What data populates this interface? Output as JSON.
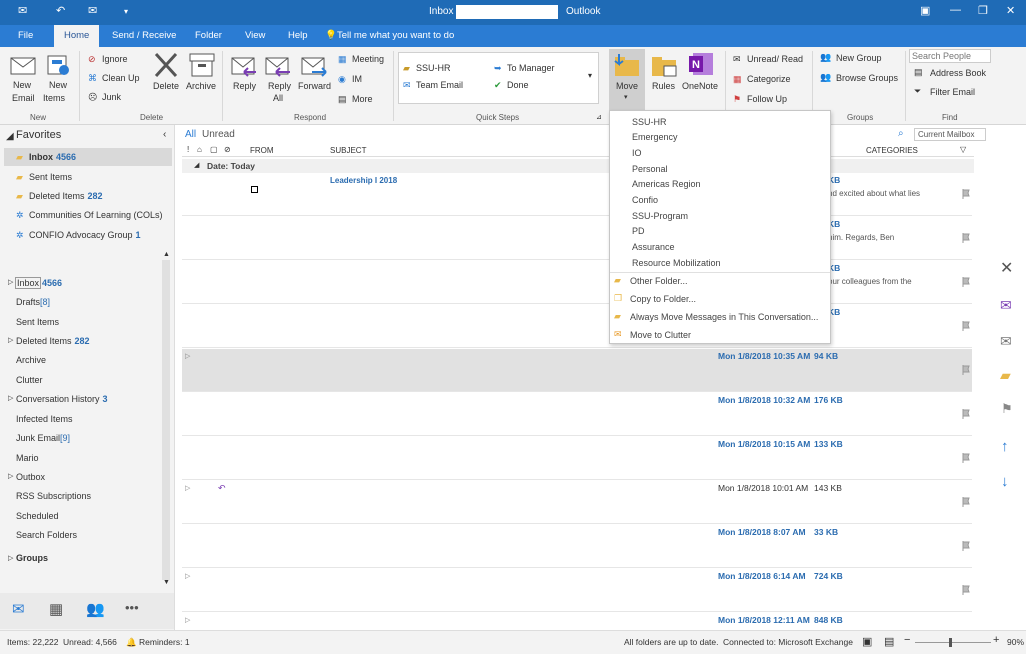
{
  "window": {
    "title_left": "Inbox",
    "title_right": "Outlook"
  },
  "tabs": [
    "File",
    "Home",
    "Send / Receive",
    "Folder",
    "View",
    "Help"
  ],
  "tell_me": "Tell me what you want to do",
  "ribbon": {
    "new": {
      "new_email": [
        "New",
        "Email"
      ],
      "new_items": [
        "New",
        "Items"
      ],
      "group": "New"
    },
    "delete": {
      "ignore": "Ignore",
      "clean_up": "Clean Up",
      "junk": "Junk",
      "delete": "Delete",
      "archive": "Archive",
      "group": "Delete"
    },
    "respond": {
      "reply": "Reply",
      "reply_all": [
        "Reply",
        "All"
      ],
      "forward": "Forward",
      "meeting": "Meeting",
      "im": "IM",
      "more": "More",
      "group": "Respond"
    },
    "quick_steps": {
      "items": [
        "SSU-HR",
        "To Manager",
        "Team Email",
        "Done"
      ],
      "group": "Quick Steps"
    },
    "move": {
      "move": "Move",
      "rules": "Rules",
      "onenote": "OneNote"
    },
    "tags": {
      "unread_read": "Unread/ Read",
      "categorize": "Categorize",
      "follow_up": "Follow Up"
    },
    "groups": {
      "new_group": "New Group",
      "browse_groups": "Browse Groups",
      "group": "Groups"
    },
    "find": {
      "search_people": "Search People",
      "address_book": "Address Book",
      "filter_email": "Filter Email",
      "group": "Find"
    }
  },
  "favorites": {
    "header": "Favorites",
    "items": [
      {
        "label": "Inbox",
        "count": "4566"
      },
      {
        "label": "Sent Items",
        "count": ""
      },
      {
        "label": "Deleted Items",
        "count": "282"
      },
      {
        "label": "Communities Of Learning (COLs)",
        "count": ""
      },
      {
        "label": "CONFIO Advocacy Group",
        "count": "1"
      }
    ]
  },
  "folders": [
    {
      "label": "Inbox",
      "count": "4566"
    },
    {
      "label": "Drafts",
      "count": "[8]"
    },
    {
      "label": "Sent Items",
      "count": ""
    },
    {
      "label": "Deleted Items",
      "count": "282"
    },
    {
      "label": "Archive",
      "count": ""
    },
    {
      "label": "Clutter",
      "count": ""
    },
    {
      "label": "Conversation History",
      "count": "3"
    },
    {
      "label": "Infected Items",
      "count": ""
    },
    {
      "label": "Junk Email",
      "count": "[9]"
    },
    {
      "label": "Mario",
      "count": ""
    },
    {
      "label": "Outbox",
      "count": ""
    },
    {
      "label": "RSS Subscriptions",
      "count": ""
    },
    {
      "label": "Scheduled",
      "count": ""
    },
    {
      "label": "Search Folders",
      "count": ""
    },
    {
      "label": "Groups",
      "count": ""
    }
  ],
  "list": {
    "filter_all": "All",
    "filter_unread": "Unread",
    "search_scope": "Current Mailbox",
    "col_from": "FROM",
    "col_subject": "SUBJECT",
    "col_categories": "CATEGORIES",
    "group_header": "Date: Today",
    "rows": [
      {
        "date": "",
        "size": "KB",
        "preview": "nd excited about what lies",
        "unread": true
      },
      {
        "date": "",
        "size": "KB",
        "preview": "him.  Regards,  Ben",
        "unread": true
      },
      {
        "date": "",
        "size": "KB",
        "preview": "our colleagues from the",
        "unread": true
      },
      {
        "date": "",
        "size": "KB",
        "preview": "",
        "unread": true
      },
      {
        "date": "Mon 1/8/2018 10:35 AM",
        "size": "94 KB",
        "preview": "",
        "unread": true
      },
      {
        "date": "Mon 1/8/2018 10:32 AM",
        "size": "176 KB",
        "preview": "",
        "unread": true
      },
      {
        "date": "Mon 1/8/2018 10:15 AM",
        "size": "133 KB",
        "preview": "",
        "unread": true
      },
      {
        "date": "Mon 1/8/2018 10:01 AM",
        "size": "143 KB",
        "preview": "",
        "unread": false
      },
      {
        "date": "Mon 1/8/2018 8:07 AM",
        "size": "33 KB",
        "preview": "",
        "unread": true
      },
      {
        "date": "Mon 1/8/2018 6:14 AM",
        "size": "724 KB",
        "preview": "",
        "unread": true
      },
      {
        "date": "Mon 1/8/2018 12:11 AM",
        "size": "848 KB",
        "preview": "",
        "unread": true
      }
    ]
  },
  "move_menu": {
    "folders": [
      "SSU-HR",
      "Emergency",
      "IO",
      "Personal",
      "Americas Region",
      "Confio",
      "SSU-Program",
      "PD",
      "Assurance",
      "Resource Mobilization"
    ],
    "actions": [
      "Other Folder...",
      "Copy to Folder...",
      "Always Move Messages in This Conversation...",
      "Move to Clutter"
    ]
  },
  "status": {
    "items": "Items: 22,222",
    "unread": "Unread: 4,566",
    "reminders": "Reminders: 1",
    "sync": "All folders are up to date.",
    "connection": "Connected to: Microsoft Exchange",
    "zoom": "90%"
  },
  "colors": {
    "accent": "#2b7cd3",
    "title": "#1f6bb6",
    "link": "#2b6cb0"
  }
}
